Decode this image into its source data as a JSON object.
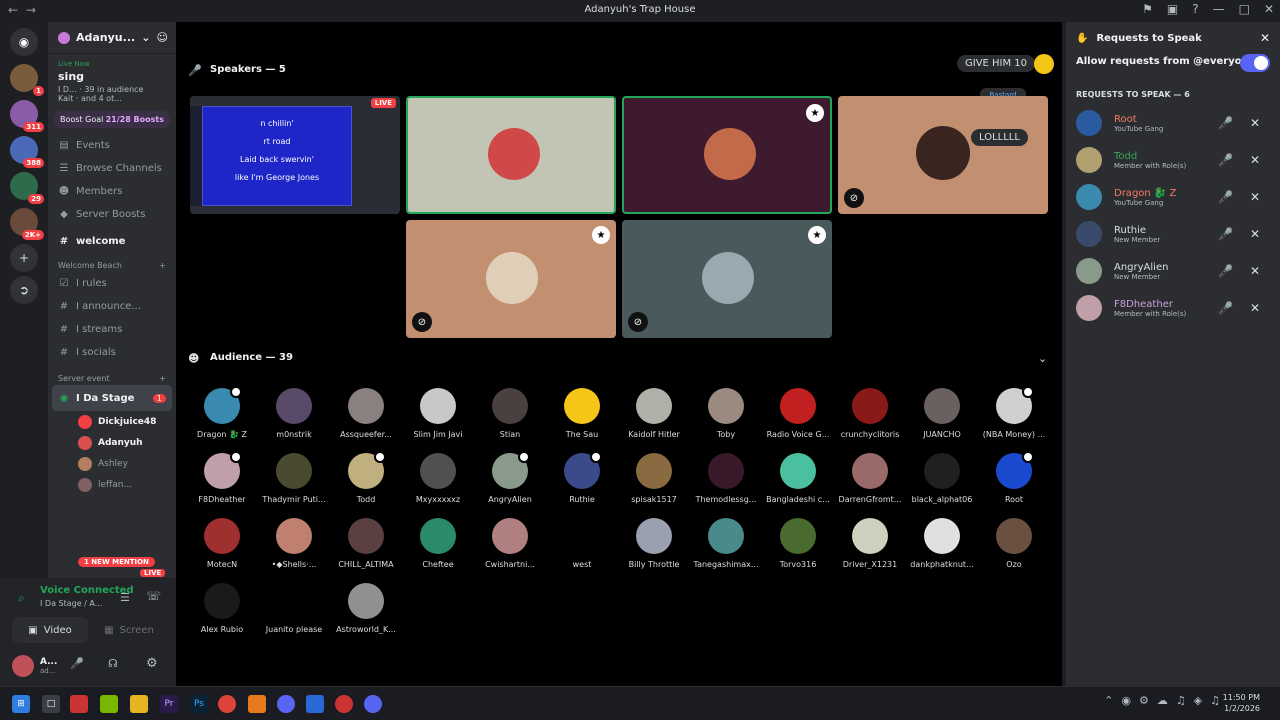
{
  "window": {
    "title": "Adanyuh's Trap House"
  },
  "server": {
    "name": "Adanyu...",
    "live_label": "Live Now",
    "live_stage": "sing",
    "live_meta": "I D... · 39 in audience",
    "live_people": "Kait · and 4 ot...",
    "boost_label": "Boost Goal",
    "boost_value": "21/28 Boosts"
  },
  "guild_badges": [
    "1",
    "311",
    "388",
    "29",
    "2K+"
  ],
  "nav_items": [
    "Events",
    "Browse Channels",
    "Members",
    "Server Boosts"
  ],
  "welcome_channel": "welcome",
  "category1": "Welcome Beach",
  "channels": [
    "I rules",
    "I announce...",
    "I streams",
    "I socials"
  ],
  "category2": "Server event",
  "stage_channel": {
    "name": "I Da Stage",
    "sub": "sing",
    "badge": "1"
  },
  "stage_users": [
    "Dickjuice48",
    "Adanyuh",
    "Ashley",
    "leffan..."
  ],
  "new_mention": "1 NEW MENTION",
  "live_badge": "LIVE",
  "voice": {
    "title": "Voice Connected",
    "sub": "I Da Stage / A...",
    "video": "Video",
    "screen": "Screen",
    "user": "A...",
    "user_sub": "ad..."
  },
  "speakers": {
    "label": "Speakers — 5",
    "lyrics": [
      "n chillin'",
      "rt road",
      "Laid back swervin'",
      "like I'm George Jones"
    ]
  },
  "reactions": [
    "GIVE HIM 10",
    "LOLLLLL",
    "Bastard Beach"
  ],
  "audience": {
    "label": "Audience — 39",
    "members": [
      "Dragon 🐉 Z",
      "m0nstrik",
      "Assqueefer...",
      "Slim Jim Javi",
      "Stian",
      "The Sau",
      "Kaidolf Hitler",
      "Toby",
      "Radio Voice G...",
      "crunchyclitoris",
      "JUANCHO",
      "(NBA Money) ...",
      "F8Dheather",
      "Thadymir Puti...",
      "Todd",
      "Mxyxxxxxz",
      "AngryAlien",
      "Ruthie",
      "spisak1517",
      "Themodlessg...",
      "Bangladeshi c...",
      "DarrenGfromt...",
      "black_alphat06",
      "Root",
      "MotecN",
      "•◆Shells·...",
      "CHILL_ALTIMA",
      "Cheftee",
      "Cwishartni...",
      "west",
      "Billy Throttle",
      "Tanegashimax...",
      "Torvo316",
      "Driver_X1231",
      "dankphatknut...",
      "Ozo",
      "Alex Rubio",
      "Juanito please",
      "Astroworld_K..."
    ]
  },
  "requests": {
    "title": "Requests to Speak",
    "allow": "Allow requests from @everyone",
    "section": "REQUESTS TO SPEAK — 6",
    "items": [
      {
        "name": "Root",
        "role": "YouTube Gang",
        "color": "#f47b67"
      },
      {
        "name": "Todd",
        "role": "Member with Role(s)",
        "color": "#3ba55c"
      },
      {
        "name": "Dragon 🐉 Z",
        "role": "YouTube Gang",
        "color": "#f47b67"
      },
      {
        "name": "Ruthie",
        "role": "New Member",
        "color": "#dbdee1"
      },
      {
        "name": "AngryAlien",
        "role": "New Member",
        "color": "#dbdee1"
      },
      {
        "name": "F8Dheather",
        "role": "Member with Role(s)",
        "color": "#c9a0dc"
      }
    ]
  },
  "clock": {
    "time": "11:50 PM",
    "date": "1/2/2026"
  }
}
